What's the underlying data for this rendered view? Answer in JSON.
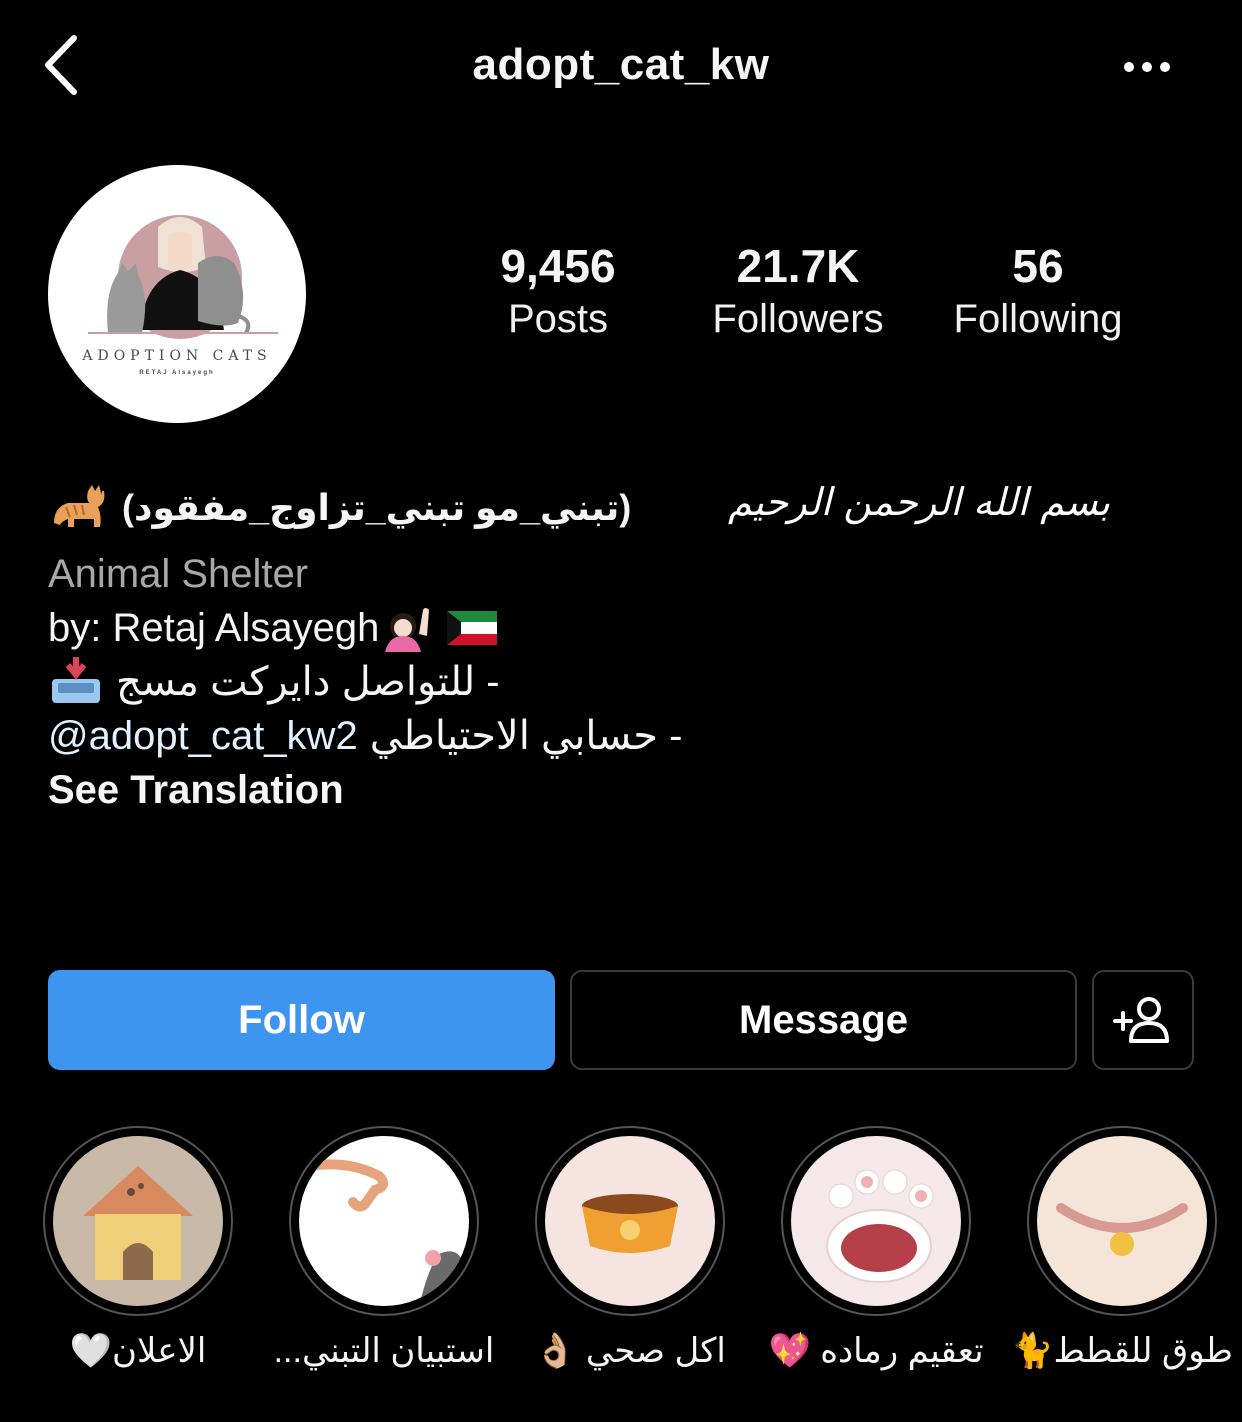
{
  "header": {
    "back_icon": "chevron-left-icon",
    "username": "adopt_cat_kw",
    "more_icon": "more-horizontal-icon"
  },
  "avatar": {
    "logo_text": "ADOPTION CATS",
    "logo_subtext": "RETAJ Alsayegh"
  },
  "stats": {
    "posts": {
      "value": "9,456",
      "label": "Posts"
    },
    "followers": {
      "value": "21.7K",
      "label": "Followers"
    },
    "following": {
      "value": "56",
      "label": "Following"
    }
  },
  "bio": {
    "name": "(تبني_مو تبني_تزاوج_مفقود)",
    "basmala": "بسم الله الرحمن الرحيم",
    "category": "Animal Shelter",
    "byline": "by: Retaj Alsayegh",
    "line3": "- للتواصل دايركت مسج",
    "line4_prefix": "- حسابي الاحتياطي",
    "line4_mention": "@adopt_cat_kw2",
    "see_translation": "See Translation"
  },
  "actions": {
    "follow": "Follow",
    "message": "Message",
    "add_person_icon": "add-person-icon"
  },
  "highlights": [
    {
      "label": "الاعلان🤍"
    },
    {
      "label": "استبيان التبني..."
    },
    {
      "label": "اكل صحي 👌🏼"
    },
    {
      "label": "تعقيم رماده 💖"
    },
    {
      "label": "طوق للقطط🐈"
    }
  ],
  "colors": {
    "background": "#000000",
    "follow_button": "#3d95f0",
    "secondary_text": "#a8a8a8",
    "mention": "#e0f1ff"
  }
}
